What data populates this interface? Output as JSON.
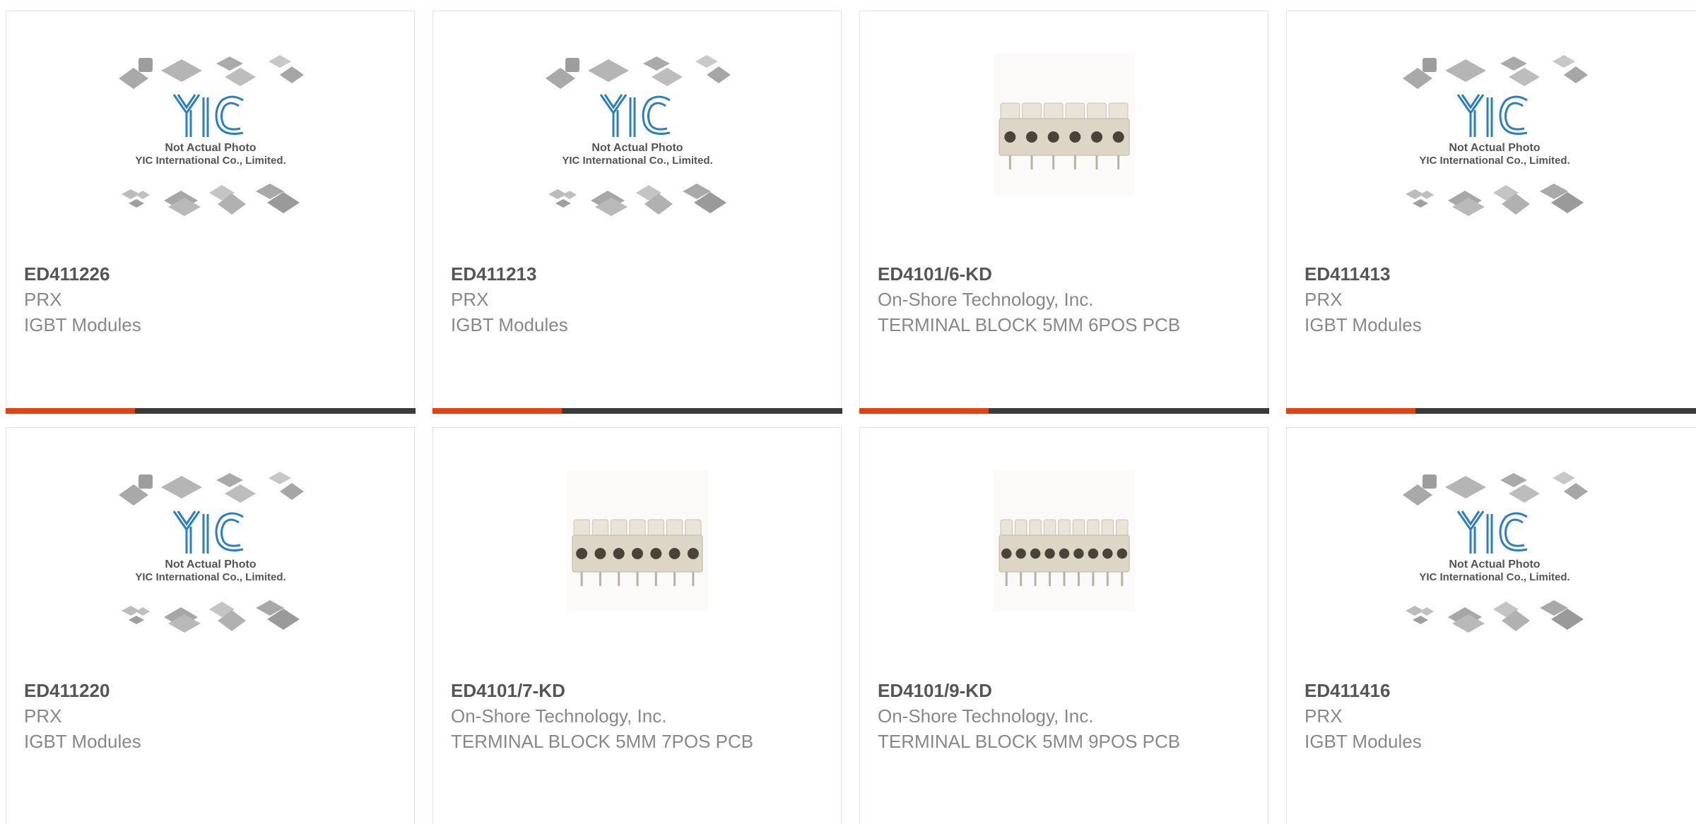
{
  "placeholder": {
    "logo_text": "YIC",
    "line1": "Not Actual Photo",
    "line2": "YIC International Co., Limited."
  },
  "colors": {
    "accent": "#e8400c",
    "bar": "#3a3a3a",
    "logo_blue": "#2a7fc0"
  },
  "products": [
    {
      "part_no": "ED411226",
      "manufacturer": "PRX",
      "description": "IGBT Modules",
      "image": "placeholder",
      "hover_bar": true
    },
    {
      "part_no": "ED411213",
      "manufacturer": "PRX",
      "description": "IGBT Modules",
      "image": "placeholder",
      "hover_bar": true
    },
    {
      "part_no": "ED4101/6-KD",
      "manufacturer": "On-Shore Technology, Inc.",
      "description": "TERMINAL BLOCK 5MM 6POS PCB",
      "image": "terminal-block",
      "positions": 6,
      "hover_bar": true
    },
    {
      "part_no": "ED411413",
      "manufacturer": "PRX",
      "description": "IGBT Modules",
      "image": "placeholder",
      "hover_bar": true
    },
    {
      "part_no": "ED411220",
      "manufacturer": "PRX",
      "description": "IGBT Modules",
      "image": "placeholder",
      "hover_bar": false
    },
    {
      "part_no": "ED4101/7-KD",
      "manufacturer": "On-Shore Technology, Inc.",
      "description": "TERMINAL BLOCK 5MM 7POS PCB",
      "image": "terminal-block",
      "positions": 7,
      "hover_bar": false
    },
    {
      "part_no": "ED4101/9-KD",
      "manufacturer": "On-Shore Technology, Inc.",
      "description": "TERMINAL BLOCK 5MM 9POS PCB",
      "image": "terminal-block",
      "positions": 9,
      "hover_bar": false
    },
    {
      "part_no": "ED411416",
      "manufacturer": "PRX",
      "description": "IGBT Modules",
      "image": "placeholder",
      "hover_bar": false
    }
  ]
}
